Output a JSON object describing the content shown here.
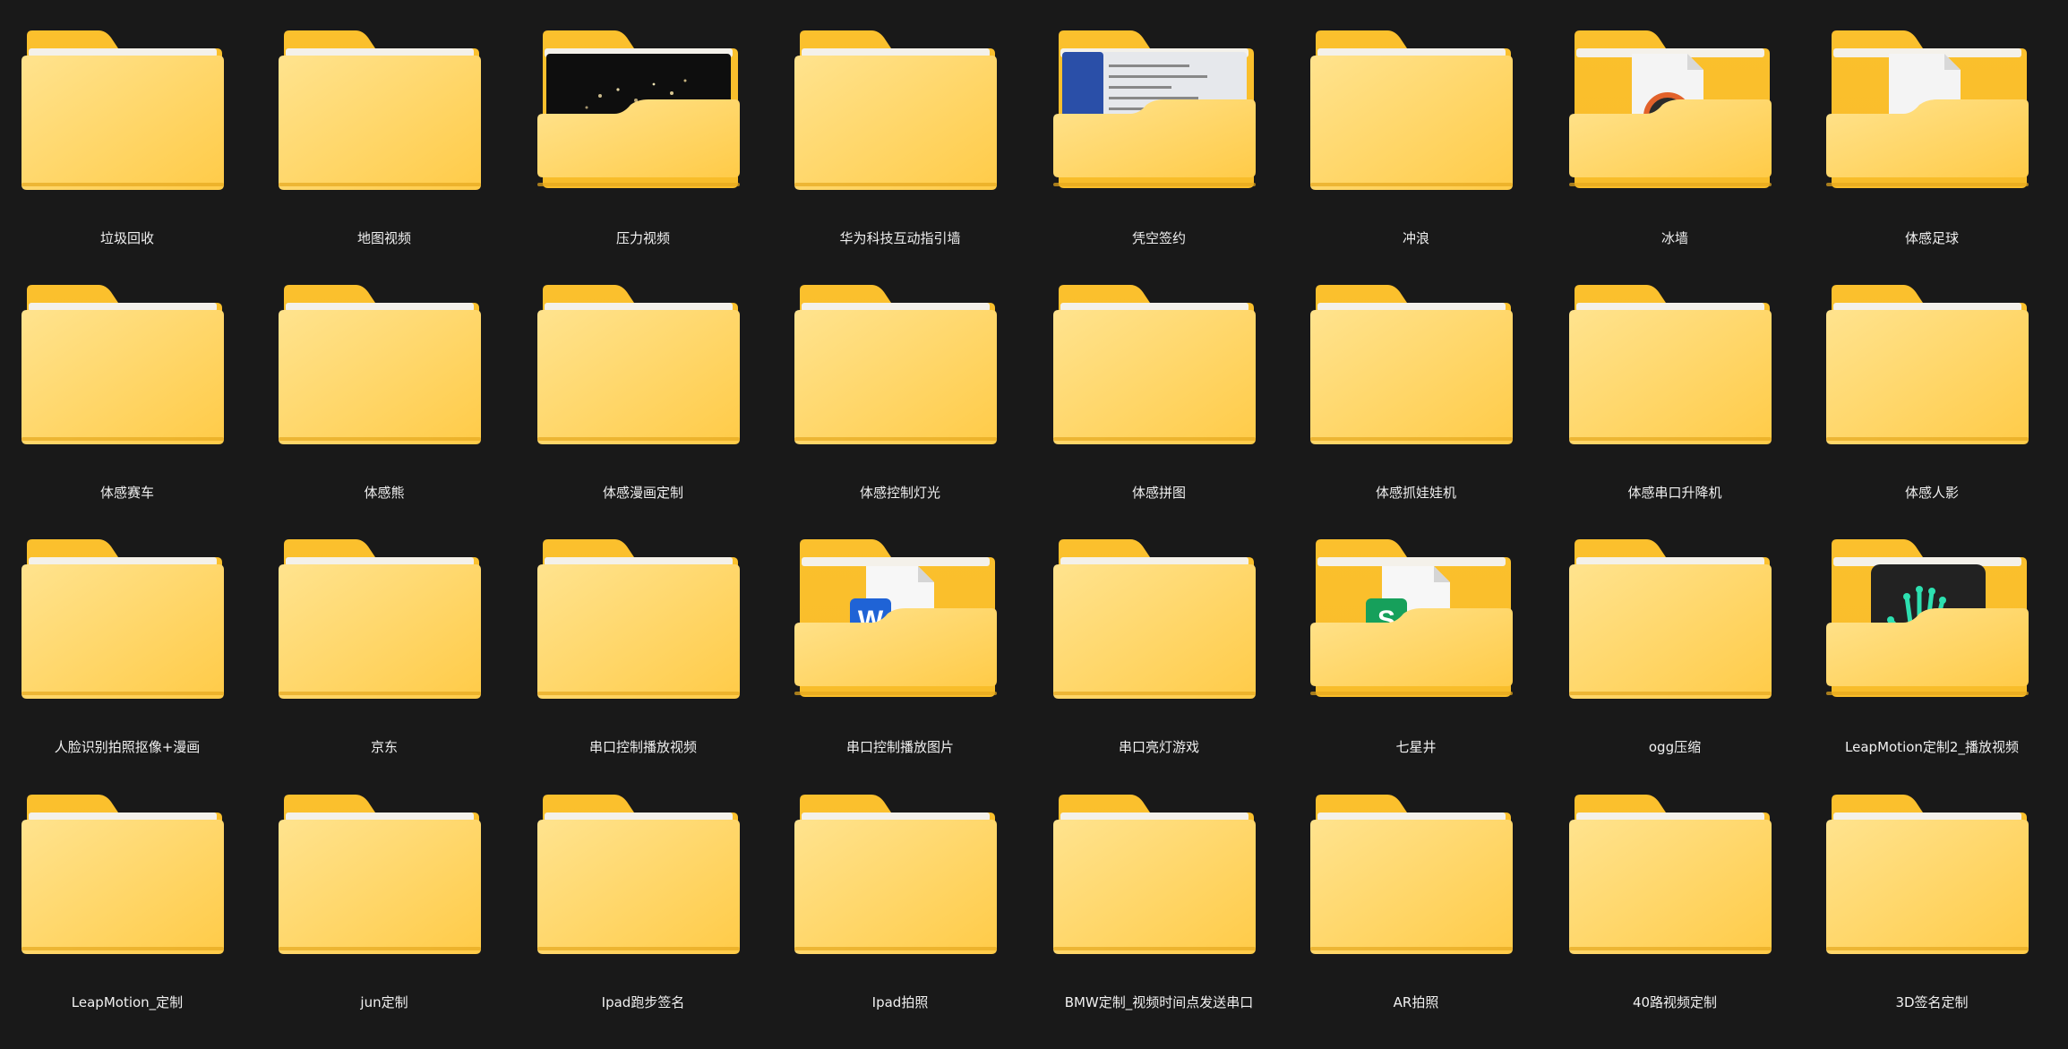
{
  "folders": [
    {
      "name": "垃圾回收",
      "preview": "none"
    },
    {
      "name": "地图视频",
      "preview": "none"
    },
    {
      "name": "压力视频",
      "preview": "dark-video-thumbnail"
    },
    {
      "name": "华为科技互动指引墙",
      "preview": "none"
    },
    {
      "name": "凭空签约",
      "preview": "screenshot-thumbnail"
    },
    {
      "name": "冲浪",
      "preview": "none"
    },
    {
      "name": "冰墙",
      "preview": "media-file-icon"
    },
    {
      "name": "体感足球",
      "preview": "blank-file-icon"
    },
    {
      "name": "体感赛车",
      "preview": "none"
    },
    {
      "name": "体感熊",
      "preview": "none"
    },
    {
      "name": "体感漫画定制",
      "preview": "none"
    },
    {
      "name": "体感控制灯光",
      "preview": "none"
    },
    {
      "name": "体感拼图",
      "preview": "none"
    },
    {
      "name": "体感抓娃娃机",
      "preview": "none"
    },
    {
      "name": "体感串口升降机",
      "preview": "none"
    },
    {
      "name": "体感人影",
      "preview": "none"
    },
    {
      "name": "人脸识别拍照抠像+漫画",
      "preview": "none"
    },
    {
      "name": "京东",
      "preview": "none"
    },
    {
      "name": "串口控制播放视频",
      "preview": "none"
    },
    {
      "name": "串口控制播放图片",
      "preview": "word-doc-icon"
    },
    {
      "name": "串口亮灯游戏",
      "preview": "none"
    },
    {
      "name": "七星井",
      "preview": "sheet-doc-icon"
    },
    {
      "name": "ogg压缩",
      "preview": "none"
    },
    {
      "name": "LeapMotion定制2_播放视频",
      "preview": "leapmotion-hand-icon"
    },
    {
      "name": "LeapMotion_定制",
      "preview": "none"
    },
    {
      "name": "jun定制",
      "preview": "none"
    },
    {
      "name": "Ipad跑步签名",
      "preview": "none"
    },
    {
      "name": "Ipad拍照",
      "preview": "none"
    },
    {
      "name": "BMW定制_视频时间点发送串口",
      "preview": "none"
    },
    {
      "name": "AR拍照",
      "preview": "none"
    },
    {
      "name": "40路视频定制",
      "preview": "none"
    },
    {
      "name": "3D签名定制",
      "preview": "none"
    }
  ],
  "colors": {
    "background": "#191919",
    "folder_back": "#F8BD2A",
    "folder_front_light": "#FFE38E",
    "folder_front_dark": "#FFCB48",
    "label_text": "#F0F0F0"
  }
}
